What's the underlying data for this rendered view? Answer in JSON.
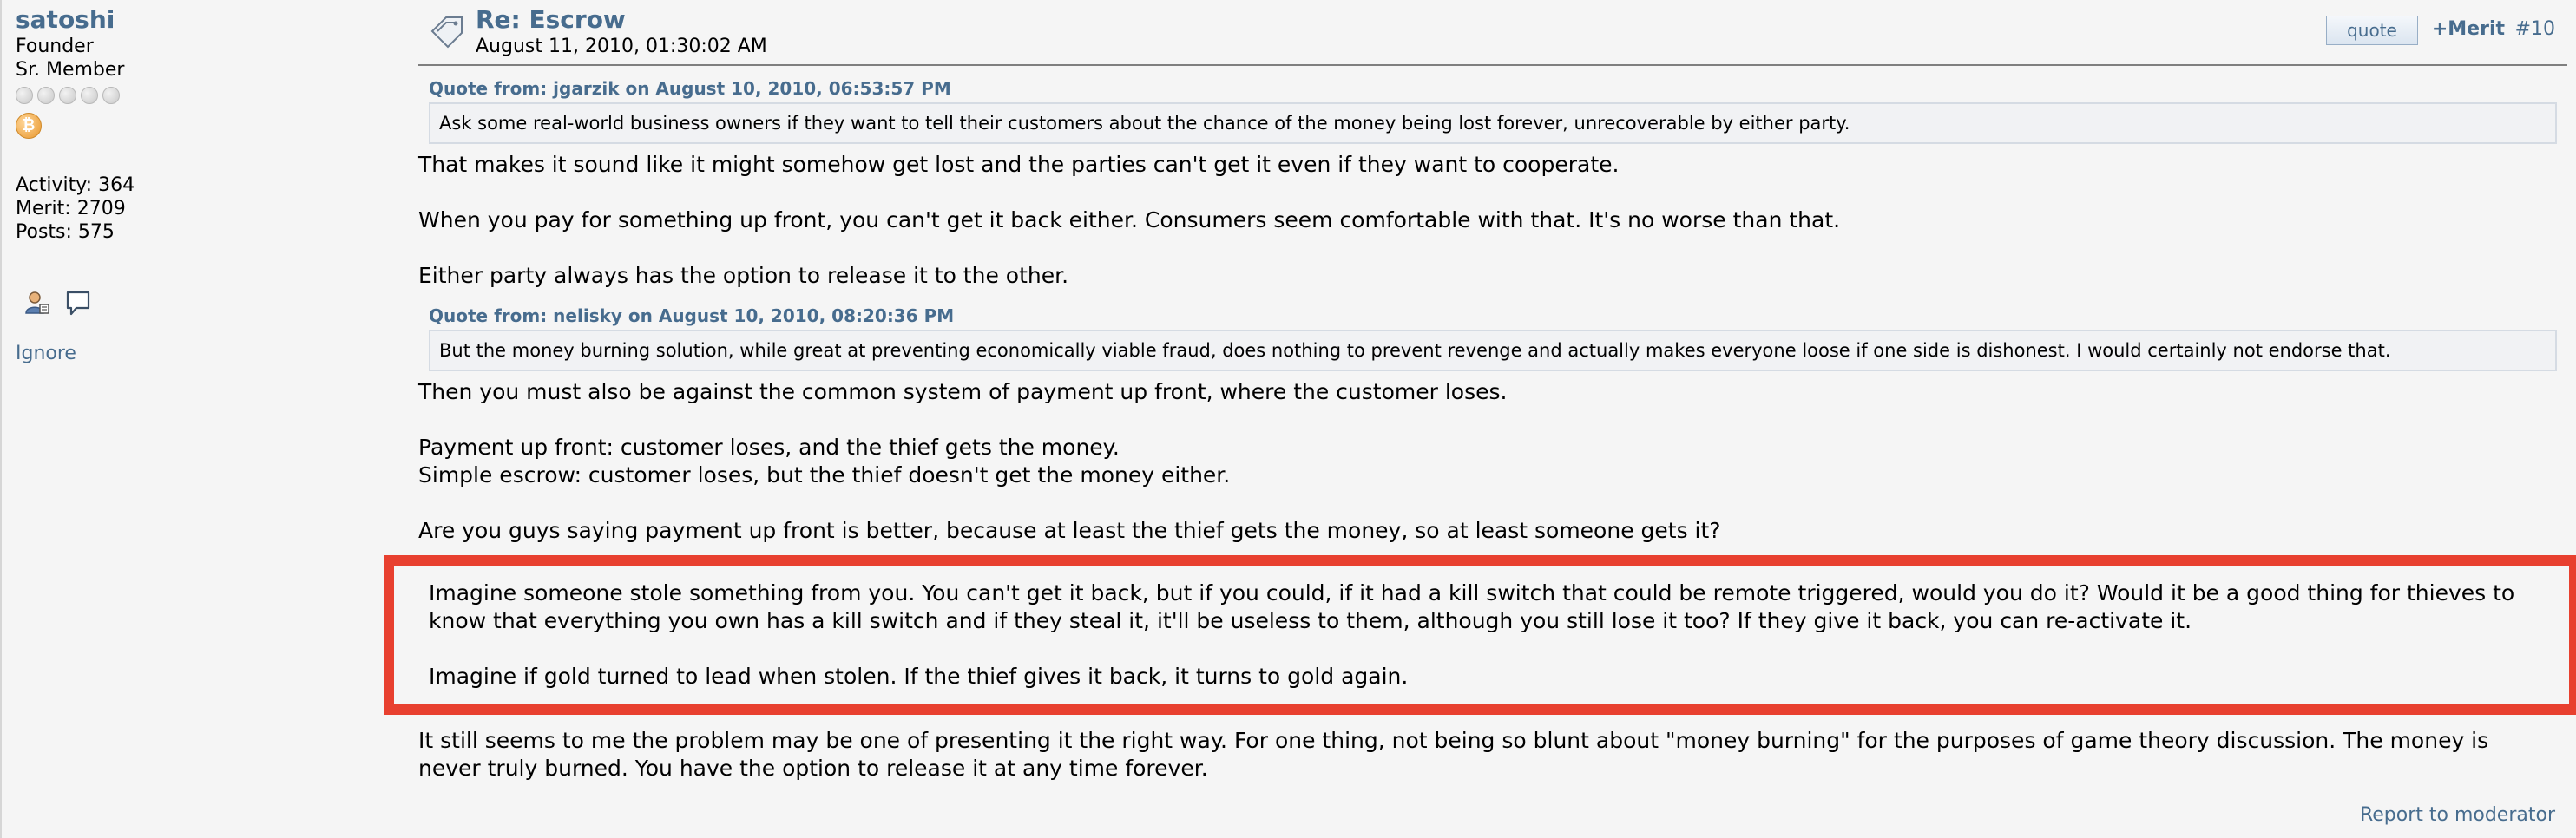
{
  "poster": {
    "name": "satoshi",
    "title": "Founder",
    "rank": "Sr. Member",
    "activity": "Activity: 364",
    "merit": "Merit: 2709",
    "posts": "Posts: 575",
    "ignore_label": "Ignore",
    "coin_symbol": "₿"
  },
  "post": {
    "subject": "Re: Escrow",
    "date": "August 11, 2010, 01:30:02 AM",
    "quote_button": "quote",
    "merit_label": "+Merit",
    "number": "#10",
    "quote1": {
      "header": "Quote from: jgarzik on August 10, 2010, 06:53:57 PM",
      "text": "Ask some real-world business owners if they want to tell their customers about the chance of the money being lost forever, unrecoverable by either party."
    },
    "para1": "That makes it sound like it might somehow get lost and the parties can't get it even if they want to cooperate.",
    "para2": "When you pay for something up front, you can't get it back either.  Consumers seem comfortable with that.  It's no worse than that.",
    "para3": "Either party always has the option to release it to the other.",
    "quote2": {
      "header": "Quote from: nelisky on August 10, 2010, 08:20:36 PM",
      "text": "But the money burning solution, while great at preventing economically viable fraud, does nothing to prevent revenge and actually makes everyone loose if one side is dishonest. I would certainly not endorse that."
    },
    "para4": "Then you must also be against the common system of payment up front, where the customer loses.",
    "para5a": "Payment up front: customer loses, and the thief gets the money.",
    "para5b": "Simple escrow: customer loses, but the thief doesn't get the money either.",
    "para6": "Are you guys saying payment up front is better, because at least the thief gets the money, so at least someone gets it?",
    "highlighted": {
      "para1": "Imagine someone stole something from you.  You can't get it back, but if you could, if it had a kill switch that could be remote triggered, would you do it?  Would it be a good thing for thieves to know that everything you own has a kill switch and if they steal it, it'll be useless to them, although you still lose it too?  If they give it back, you can re-activate it.",
      "para2": "Imagine if gold turned to lead when stolen.  If the thief gives it back, it turns to gold again.",
      "border_color": "#e8402f"
    },
    "para7": "It still seems to me the problem may be one of presenting it the right way.  For one thing, not being so blunt about \"money burning\" for the purposes of game theory discussion.  The money is never truly burned.  You have the option to release it at any time forever.",
    "report_label": "Report to moderator"
  },
  "colors": {
    "link": "#476c8e",
    "background": "#f5f5f5",
    "quote_background": "#f1f2f4",
    "highlight_border": "#e8402f"
  }
}
